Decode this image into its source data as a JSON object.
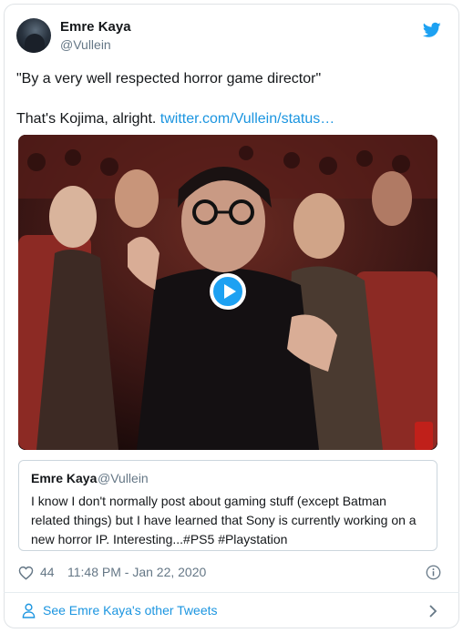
{
  "author": {
    "name": "Emre Kaya",
    "handle": "@Vullein"
  },
  "tweet": {
    "line1": "\"By a very well respected horror game director\"",
    "line2_text": "That's Kojima, alright. ",
    "link": "twitter.com/Vullein/status…"
  },
  "media": {
    "type": "video",
    "icon": "play-icon"
  },
  "quoted_tweet": {
    "name": "Emre Kaya",
    "handle": "@Vullein",
    "text": "I know I don't normally post about gaming stuff (except Batman related things) but I have learned that Sony is currently working on a new horror IP. Interesting...#PS5 #Playstation"
  },
  "meta": {
    "likes": "44",
    "timestamp": "11:48 PM - Jan 22, 2020"
  },
  "footer": {
    "see_more": "See Emre Kaya's other Tweets"
  },
  "colors": {
    "link": "#1b95e0",
    "twitter_blue": "#1da1f2",
    "secondary_text": "#657786",
    "border": "#dfe3e6"
  }
}
